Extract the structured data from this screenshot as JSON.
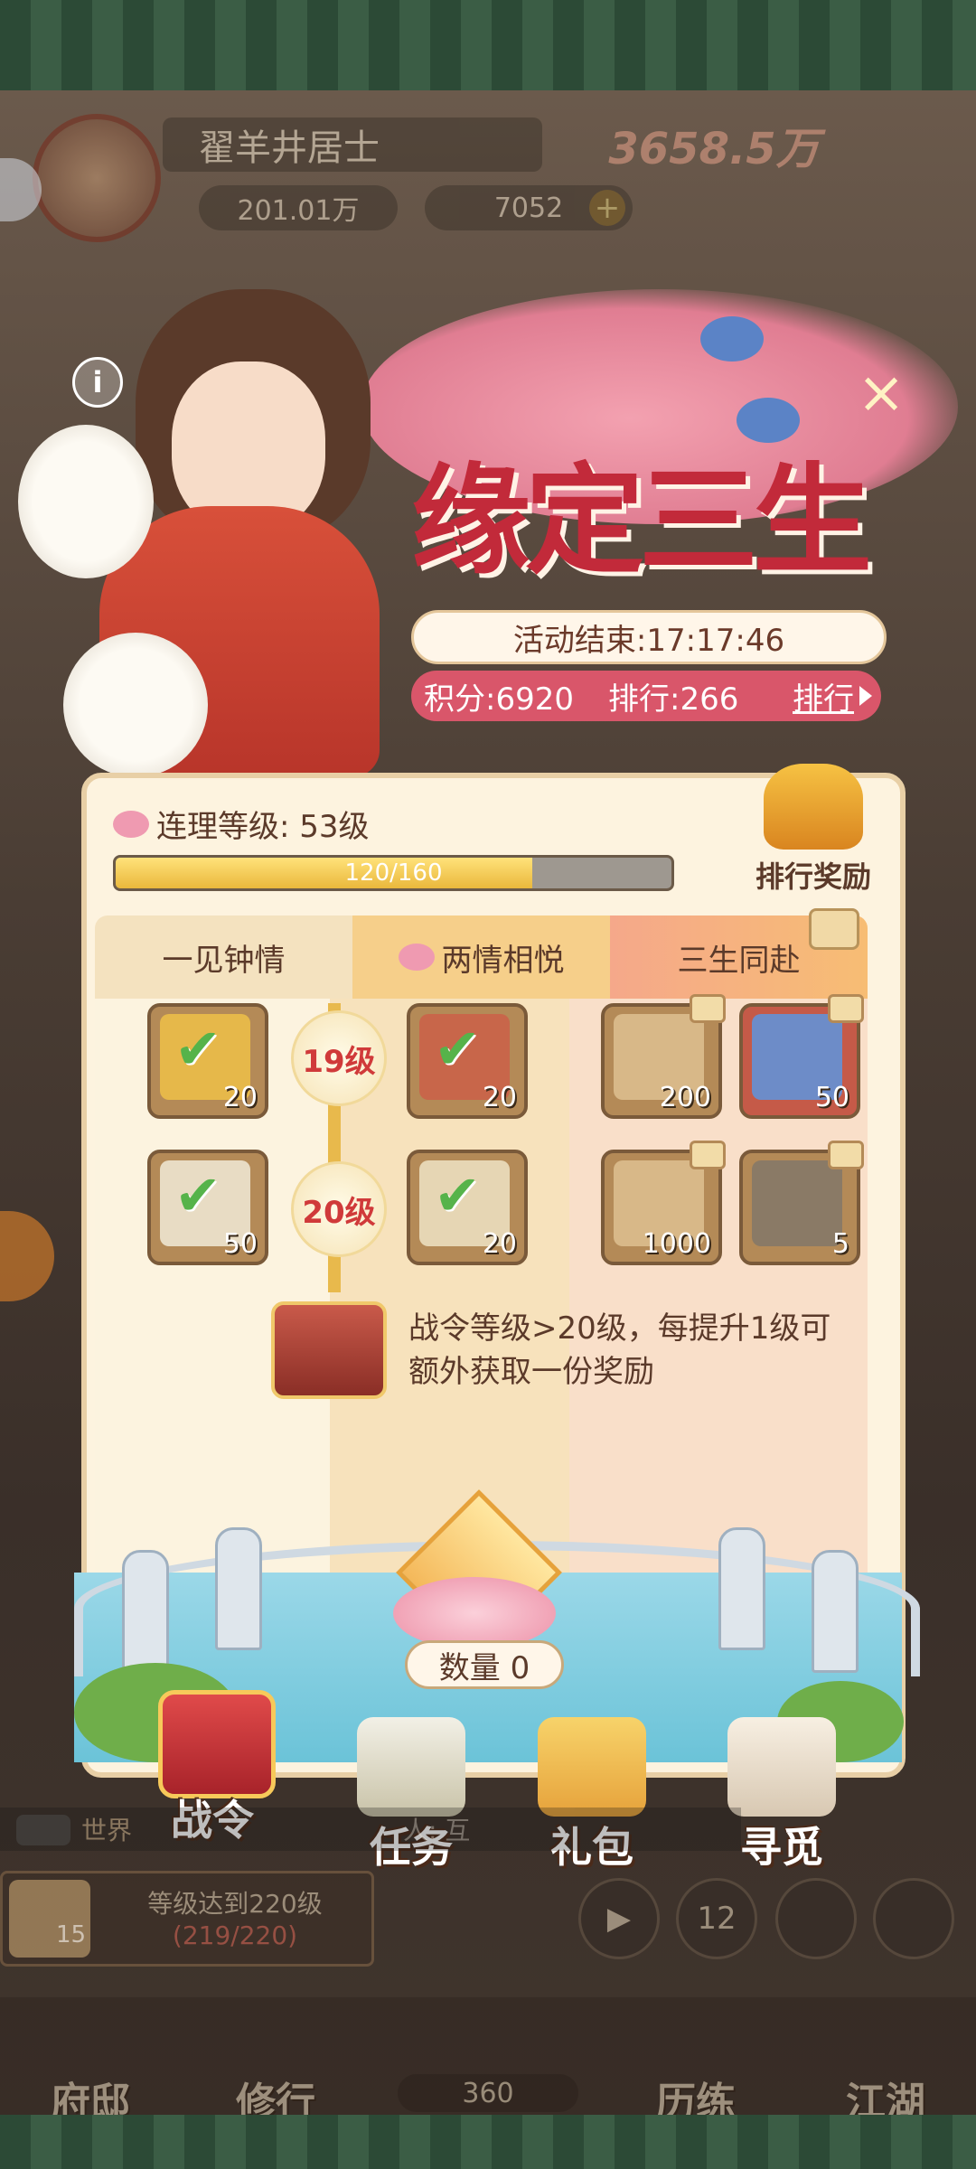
{
  "hud": {
    "player_name": "翟羊井居士",
    "power": "3658.5万",
    "silver": "201.01万",
    "gold": "7052",
    "plus_icon": "plus-icon"
  },
  "event": {
    "title": "缘定三生",
    "timer_label": "活动结束:17:17:46",
    "score_label": "积分:6920",
    "rank_label": "排行:266",
    "rank_link": "排行",
    "info_icon": "i",
    "close_icon": "×"
  },
  "panel": {
    "level_label": "连理等级: 53级",
    "progress_text": "120/160",
    "progress_fraction": 0.75,
    "rank_reward_label": "排行奖励",
    "tabs": [
      "一见钟情",
      "两情相悦",
      "三生同赴"
    ],
    "rows": [
      {
        "level": "19级",
        "free": {
          "qty": "20",
          "claimed": true,
          "icon": "gold-ingot-icon"
        },
        "mid": {
          "qty": "20",
          "claimed": true,
          "icon": "book-icon"
        },
        "premium": [
          {
            "qty": "200",
            "icon": "scroll-icon"
          },
          {
            "qty": "50",
            "icon": "token-icon"
          }
        ]
      },
      {
        "level": "20级",
        "free": {
          "qty": "50",
          "claimed": true,
          "icon": "bun-icon"
        },
        "mid": {
          "qty": "20",
          "claimed": true,
          "icon": "letter-icon"
        },
        "premium": [
          {
            "qty": "1000",
            "icon": "scroll-icon"
          },
          {
            "qty": "5",
            "icon": "card-icon"
          }
        ]
      }
    ],
    "bonus_note": "战令等级>20级，每提升1级可额外获取一份奖励",
    "quantity_label": "数量 0"
  },
  "event_nav": [
    {
      "label": "战令",
      "icon": "battle-pass-icon"
    },
    {
      "label": "任务",
      "icon": "task-icon"
    },
    {
      "label": "礼包",
      "icon": "gift-pack-icon"
    },
    {
      "label": "寻觅",
      "icon": "seek-icon"
    }
  ],
  "chat": {
    "channel": "世界",
    "partial": "人: 互"
  },
  "quest": {
    "count": "15",
    "title": "等级达到220级",
    "progress": "(219/220)"
  },
  "hud_buttons": [
    "",
    "12",
    "",
    ""
  ],
  "bottom_nav": {
    "items": [
      "府邸",
      "修行",
      "历练",
      "江湖"
    ],
    "center_count": "360"
  },
  "colors": {
    "title_red": "#c22a3a",
    "score_bar": "#d9566a",
    "progress_fill": "#eab83c",
    "check_green": "#56b34a"
  }
}
